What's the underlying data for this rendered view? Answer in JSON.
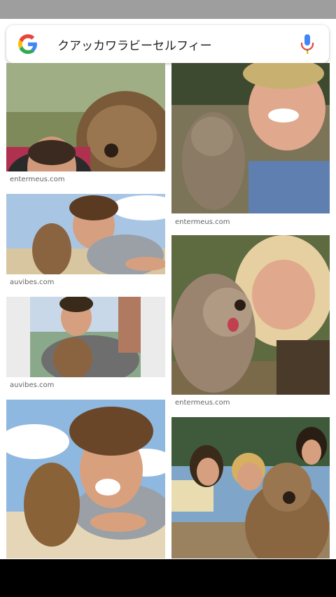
{
  "search": {
    "query": "クアッカワラビーセルフィー",
    "logo": "google-g-icon",
    "mic_icon": "microphone-icon"
  },
  "results": [
    {
      "caption": "entermeus.com"
    },
    {
      "caption": "auvibes.com"
    },
    {
      "caption": "auvibes.com"
    },
    {
      "caption": ""
    },
    {
      "caption": "entermeus.com"
    },
    {
      "caption": "entermeus.com"
    },
    {
      "caption": ""
    }
  ],
  "colors": {
    "google_blue": "#4285F4",
    "google_red": "#EA4335",
    "google_yellow": "#FBBC05",
    "google_green": "#34A853",
    "caption_grey": "#5f6368"
  }
}
